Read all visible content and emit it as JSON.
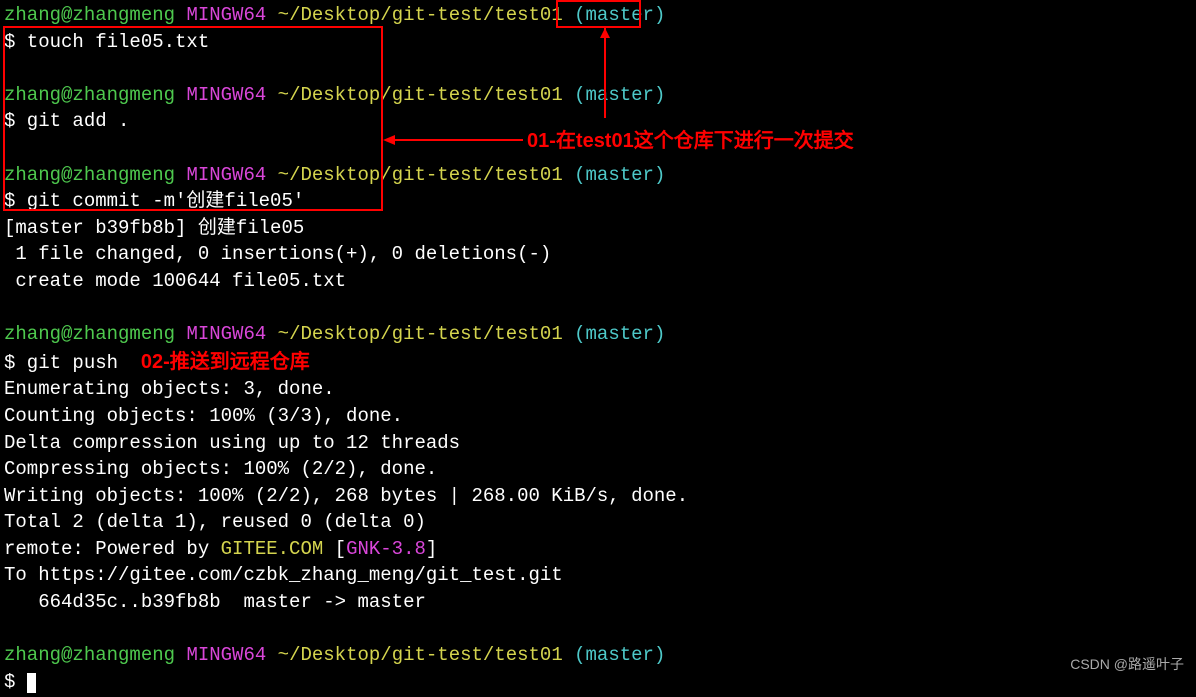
{
  "prompt": {
    "user": "zhang@zhangmeng",
    "mingw": "MINGW64",
    "path": "~/Desktop/git-test/test01",
    "branch": "(master)"
  },
  "commands": {
    "touch": "$ touch file05.txt",
    "gitadd": "$ git add .",
    "gitcommit": "$ git commit -m'创建file05'",
    "gitpush": "$ git push",
    "empty": "$ "
  },
  "output": {
    "commit1": "[master b39fb8b] 创建file05",
    "commit2": " 1 file changed, 0 insertions(+), 0 deletions(-)",
    "commit3": " create mode 100644 file05.txt",
    "push1": "Enumerating objects: 3, done.",
    "push2": "Counting objects: 100% (3/3), done.",
    "push3": "Delta compression using up to 12 threads",
    "push4": "Compressing objects: 100% (2/2), done.",
    "push5": "Writing objects: 100% (2/2), 268 bytes | 268.00 KiB/s, done.",
    "push6": "Total 2 (delta 1), reused 0 (delta 0)",
    "push7a": "remote: Powered by ",
    "push7b": "GITEE.COM",
    "push7c": " [",
    "push7d": "GNK-3.8",
    "push7e": "]",
    "push8": "To https://gitee.com/czbk_zhang_meng/git_test.git",
    "push9": "   664d35c..b39fb8b  master -> master"
  },
  "annotations": {
    "ann1": "01-在test01这个仓库下进行一次提交",
    "ann2": "02-推送到远程仓库"
  },
  "watermark": "CSDN @路遥叶子"
}
